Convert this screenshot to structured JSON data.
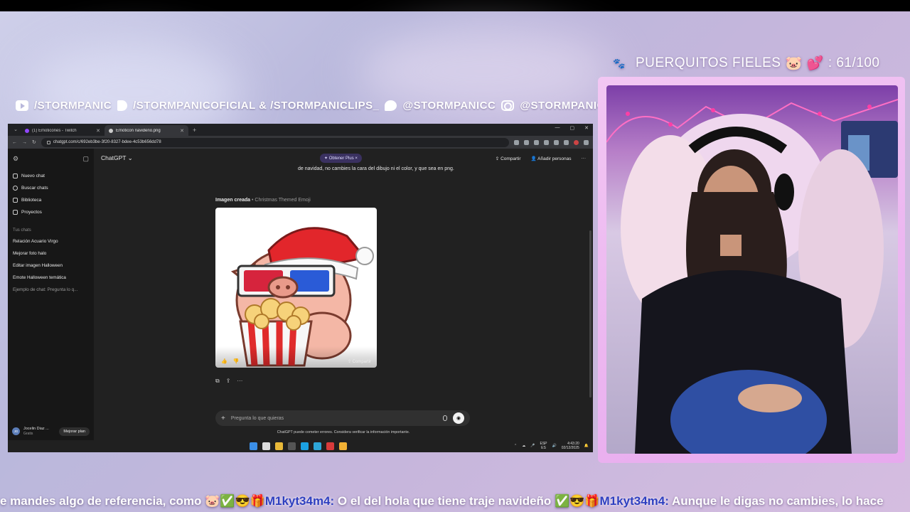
{
  "overlay": {
    "socials": [
      {
        "icon": "youtube-icon",
        "text": "/STORMPANIC"
      },
      {
        "icon": "tiktok-icon",
        "text": "/STORMPANICOFICIAL & /STORMPANICLIPS_"
      },
      {
        "icon": "twitter-icon",
        "text": "@STORMPANICC"
      },
      {
        "icon": "instagram-icon",
        "text": "@STORMPANIC"
      }
    ],
    "counter": {
      "label": "PUERQUITOS FIELES",
      "value": ": 61/100",
      "emoji_1": "🐷",
      "emoji_2": "💕"
    }
  },
  "browser": {
    "tabs": [
      {
        "label": "(1) Emoticones - Twitch",
        "active": false
      },
      {
        "label": "Emoticon navideño.png",
        "active": true
      }
    ],
    "new_tab": "+",
    "url": "chatgpt.com/c/692eb3be-3f20-8327-bdee-4c53b656dd78",
    "window_controls": [
      "—",
      "▢",
      "✕"
    ]
  },
  "chatgpt": {
    "sidebar": {
      "items": [
        {
          "icon": "edit-icon",
          "label": "Nuevo chat"
        },
        {
          "icon": "search-icon",
          "label": "Buscar chats"
        },
        {
          "icon": "library-icon",
          "label": "Biblioteca"
        },
        {
          "icon": "folder-icon",
          "label": "Proyectos"
        }
      ],
      "section_title": "Tus chats",
      "chats": [
        "Relación Acuario Virgo",
        "Mejorar foto halo",
        "Editar imagen Halloween",
        "Emote Halloween temática",
        "Ejemplo de chat: Pregunta lo q..."
      ],
      "user": {
        "initials": "JG",
        "name": "Jocelin Diaz ...",
        "plan": "Gratis",
        "upgrade": "Mejorar plan"
      }
    },
    "header": {
      "model": "ChatGPT ⌄",
      "plus_pill": "✦ Obtener Plus  ×",
      "share": "Compartir",
      "add_people": "Añadir personas",
      "more": "···"
    },
    "prompt_tail": "de navidad, no cambies la cara del dibujo ni el color, y que sea en png.",
    "image": {
      "label": "Imagen creada",
      "title": "Christmas Themed Emoji",
      "share": "Compartir"
    },
    "composer": {
      "placeholder": "Pregunta lo que quieras"
    },
    "disclaimer": "ChatGPT puede cometer errores. Considera verificar la información importante."
  },
  "taskbar": {
    "lang_1": "ESP",
    "lang_2": "ES",
    "time": "4:43:20",
    "date": "02/12/2025"
  },
  "ticker": {
    "segments": [
      {
        "type": "text",
        "value": "e mandes algo de referencia, como "
      },
      {
        "type": "emotes",
        "value": "🐷✅😎🎁"
      },
      {
        "type": "user",
        "value": "M1kyt34m4:"
      },
      {
        "type": "text",
        "value": " O el del hola que tiene traje navideño "
      },
      {
        "type": "emotes",
        "value": "✅😎🎁"
      },
      {
        "type": "user",
        "value": "M1kyt34m4:"
      },
      {
        "type": "text",
        "value": " Aunque le digas no cambies, lo hace"
      }
    ]
  },
  "colors": {
    "accent": "#9147ff",
    "ticker_user": "#2e3fc0",
    "frame_pink": "#f2c7f3"
  }
}
